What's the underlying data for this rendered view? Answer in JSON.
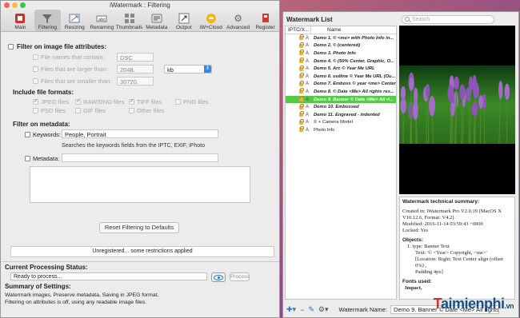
{
  "left_window": {
    "title": "iWatermark : Filtering",
    "toolbar": [
      {
        "label": "Main",
        "icon": "app-icon"
      },
      {
        "label": "Filtering",
        "icon": "filter-icon",
        "active": true
      },
      {
        "label": "Resizing",
        "icon": "resize-icon"
      },
      {
        "label": "Renaming",
        "icon": "rename-icon"
      },
      {
        "label": "Thumbnails",
        "icon": "thumbnails-icon"
      },
      {
        "label": "Metadata",
        "icon": "metadata-icon"
      },
      {
        "label": "Output",
        "icon": "output-icon"
      },
      {
        "label": "iW+Cloud",
        "icon": "cloud-icon"
      },
      {
        "label": "Advanced",
        "icon": "gear-icon"
      },
      {
        "label": "Register",
        "icon": "register-icon"
      }
    ],
    "filter_attr": {
      "heading": "Filter on image file attributes:",
      "name_contains_label": "File names that contain:",
      "name_contains_value": "DSC",
      "larger_label": "Files that are larger than:",
      "larger_value": "2048.",
      "unit": "kb",
      "smaller_label": "Files that are smaller than:",
      "smaller_value": "30720."
    },
    "formats": {
      "heading": "Include file formats:",
      "jpeg": "JPEG files",
      "raw": "RAW/DNG files",
      "tiff": "TIFF files",
      "png": "PNG files",
      "psd": "PSD files",
      "gif": "GIF files",
      "other": "Other files"
    },
    "metadata_filter": {
      "heading": "Filter on metadata:",
      "keywords_label": "Keywords:",
      "keywords_value": "People, Portrait",
      "keywords_hint": "Searches the keywords fields from the IPTC, EXIF, iPhoto",
      "metadata_label": "Metadata:"
    },
    "reset_button": "Reset Filtering to Defaults",
    "registration_notice": "Unregistered... some restrictions applied",
    "status": {
      "heading": "Current Processing Status:",
      "value": "Ready to process...",
      "process_button": "Process"
    },
    "summary": {
      "heading": "Summary of Settings:",
      "line1": "Watermark images, Preserve metadata, Saving in JPEG format,",
      "line2": "Filtering on attributes is off, using any readable image files."
    }
  },
  "right_window": {
    "title": "Watermark List",
    "search_placeholder": "Search",
    "columns": [
      "IPTC/X...",
      "Name"
    ],
    "rows": [
      {
        "name": "Demo  1. © <me> with Photo Info in...",
        "style": "bold"
      },
      {
        "name": "Demo  2. © (centered)",
        "style": "bold"
      },
      {
        "name": "Demo  3. Photo Info",
        "style": "bold"
      },
      {
        "name": "Demo  4. © (50% Center, Graphic, O...",
        "style": "bold"
      },
      {
        "name": "Demo  5. Arc © Year Me URL",
        "style": "bold"
      },
      {
        "name": "Demo  6. outline © Year Me URL (Ou...",
        "style": "bold"
      },
      {
        "name": "Demo  7. Emboss © year <me> Center",
        "style": "bold"
      },
      {
        "name": "Demo  8. © Date <Me> All rights res...",
        "style": "bold"
      },
      {
        "name": "Demo  9. Banner © Date <Me> All ri...",
        "style": "bold",
        "selected": true
      },
      {
        "name": "Demo 10. Embossed",
        "style": "bold"
      },
      {
        "name": "Demo 11. Engraved - indented",
        "style": "bold"
      },
      {
        "name": "© + Camera Model",
        "style": "plain"
      },
      {
        "name": "Photo Info",
        "style": "plain"
      }
    ],
    "tech_summary": {
      "heading": "Watermark technical summary:",
      "created": "Created in: iWatermark Pro V2.0.19 (MacOS X V10.12.6, Format: V4.2)",
      "modified": "Modified: 2016-11-14 03:59:43 +0000",
      "locked": "Locked: Yes",
      "objects_heading": "Objects:",
      "obj_type": "1.      type: Banner Text",
      "obj_text": "Text: '© <Year> Copyright, <me>'",
      "obj_location": "[Location: Right; Text Center align (offset 0%) ,",
      "obj_padding": "Padding 4px]",
      "fonts_heading": "Fonts used:",
      "font_item": "Impact,"
    },
    "watermark_name_label": "Watermark Name:",
    "watermark_name_value": "Demo  9. Banner © Date <Me> All rights reserved",
    "logo_text": "Taimienphi",
    "logo_suffix": ".vn"
  },
  "colors": {
    "selection_green": "#55c948",
    "accent_blue": "#3d85e0",
    "close_red": "#fc605b",
    "minimize_yellow": "#fdbc40",
    "zoom_green": "#34c84a"
  }
}
